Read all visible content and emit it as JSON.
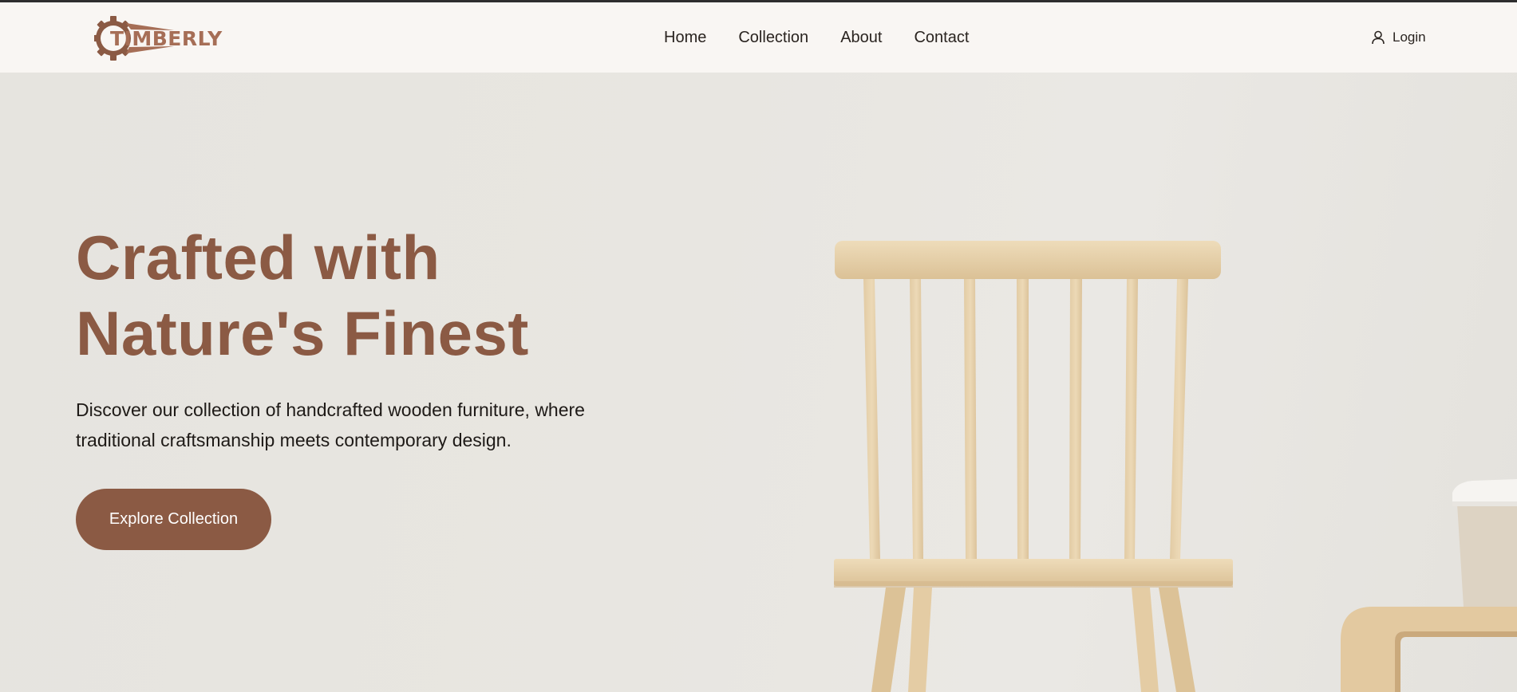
{
  "brand": {
    "name": "TIMBERLY",
    "color": "#a66e56"
  },
  "nav": {
    "items": [
      {
        "label": "Home"
      },
      {
        "label": "Collection"
      },
      {
        "label": "About"
      },
      {
        "label": "Contact"
      }
    ]
  },
  "account": {
    "login_label": "Login",
    "icon": "user-icon"
  },
  "hero": {
    "title_line1": "Crafted with",
    "title_line2": "Nature's Finest",
    "description_line1": "Discover our collection of handcrafted wooden furniture, where",
    "description_line2": "traditional craftsmanship meets contemporary design.",
    "cta_label": "Explore Collection",
    "accent_color": "#8b5a44",
    "background_image": "wooden-chair-and-coffee-cup"
  }
}
